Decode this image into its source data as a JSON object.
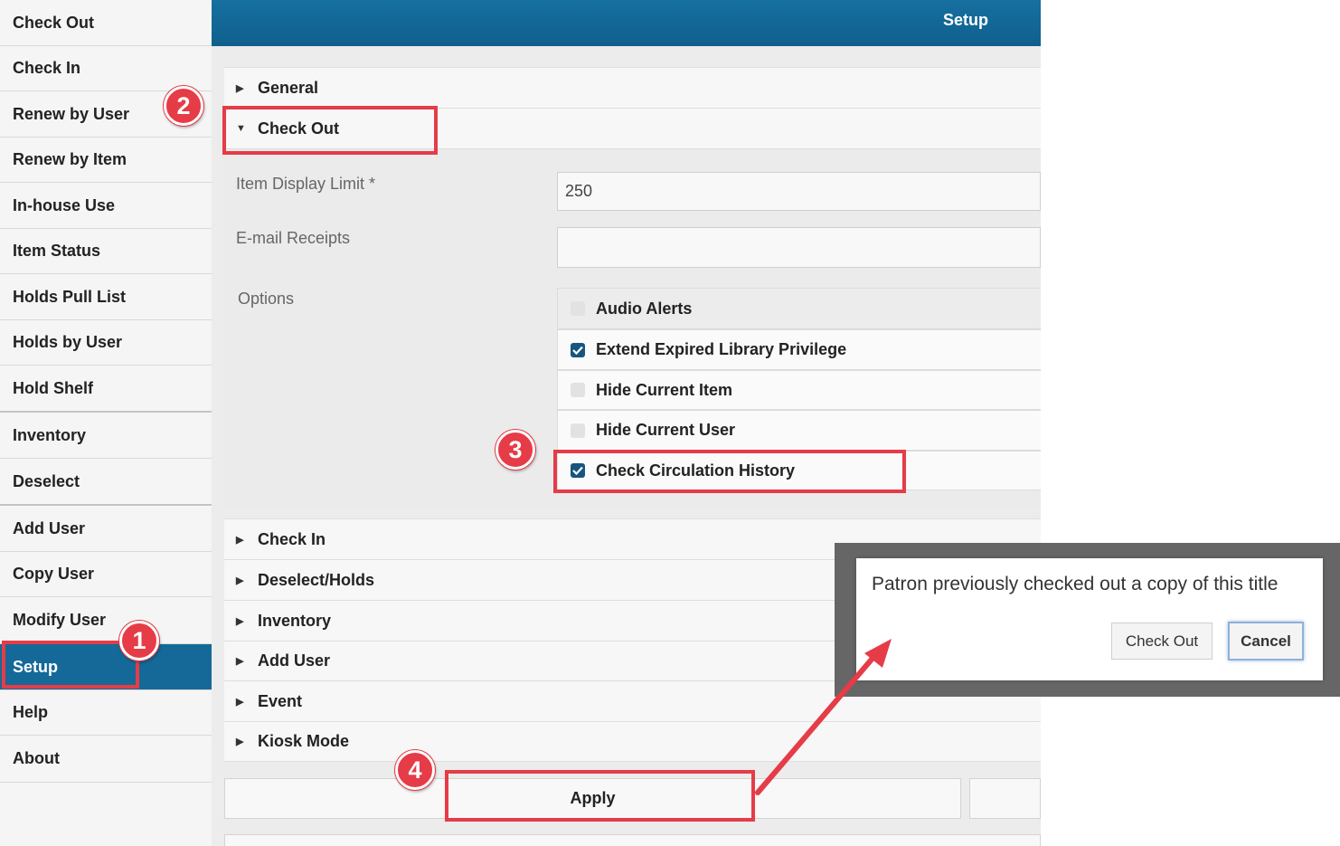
{
  "sidebar": {
    "items": [
      {
        "label": "Check Out"
      },
      {
        "label": "Check In"
      },
      {
        "label": "Renew by User"
      },
      {
        "label": "Renew by Item"
      },
      {
        "label": "In-house Use"
      },
      {
        "label": "Item Status"
      },
      {
        "label": "Holds Pull List"
      },
      {
        "label": "Holds by User"
      },
      {
        "label": "Hold Shelf"
      },
      {
        "label": "Inventory"
      },
      {
        "label": "Deselect"
      },
      {
        "label": "Add User"
      },
      {
        "label": "Copy User"
      },
      {
        "label": "Modify User"
      },
      {
        "label": "Setup"
      },
      {
        "label": "Help"
      },
      {
        "label": "About"
      }
    ]
  },
  "header": {
    "title": "Setup"
  },
  "sections": {
    "general": "General",
    "check_out": "Check Out",
    "collapsed": [
      "Check In",
      "Deselect/Holds",
      "Inventory",
      "Add User",
      "Event",
      "Kiosk Mode"
    ]
  },
  "form": {
    "item_display_limit": {
      "label": "Item Display Limit *",
      "value": "250"
    },
    "email_receipts": {
      "label": "E-mail Receipts",
      "value": ""
    },
    "options_label": "Options",
    "options": [
      {
        "label": "Audio Alerts",
        "checked": false
      },
      {
        "label": "Extend Expired Library Privilege",
        "checked": true
      },
      {
        "label": "Hide Current Item",
        "checked": false
      },
      {
        "label": "Hide Current User",
        "checked": false
      },
      {
        "label": "Check Circulation History",
        "checked": true
      }
    ]
  },
  "actions": {
    "apply": "Apply"
  },
  "dialog": {
    "message": "Patron previously checked out a copy of this title",
    "check_out": "Check Out",
    "cancel": "Cancel"
  },
  "annotations": {
    "badges": [
      "1",
      "2",
      "3",
      "4"
    ]
  },
  "colors": {
    "accent": "#156998",
    "highlight": "#e53c47"
  }
}
